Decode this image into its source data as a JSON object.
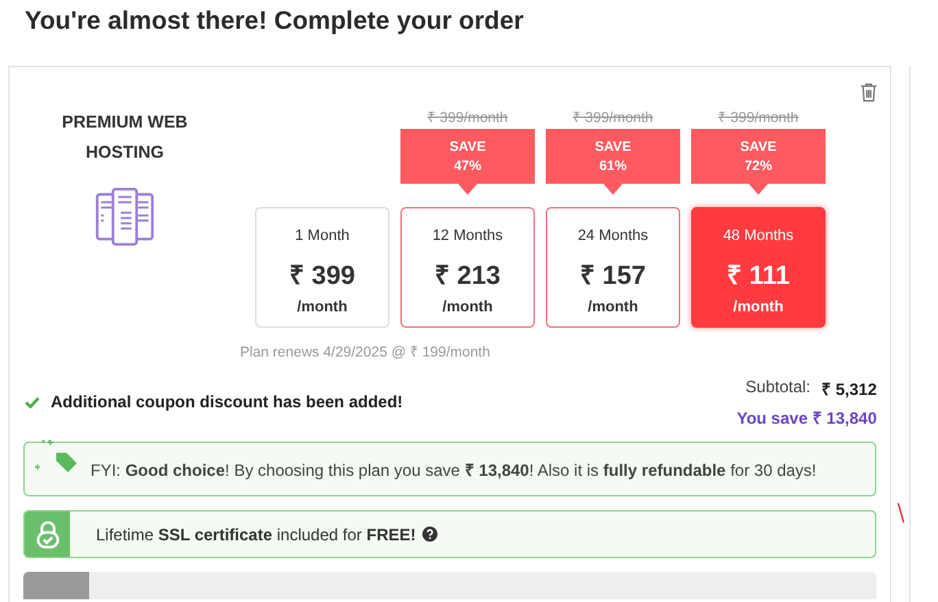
{
  "heading": "You're almost there! Complete your order",
  "product": {
    "name": "PREMIUM WEB HOSTING"
  },
  "plans": [
    {
      "term": "1 Month",
      "price": "₹ 399",
      "per": "/month",
      "selected": false
    },
    {
      "term": "12 Months",
      "price": "₹ 213",
      "per": "/month",
      "selected": false,
      "old_price": "₹ 399/month",
      "save_label": "SAVE",
      "save": "47%"
    },
    {
      "term": "24 Months",
      "price": "₹ 157",
      "per": "/month",
      "selected": false,
      "old_price": "₹ 399/month",
      "save_label": "SAVE",
      "save": "61%"
    },
    {
      "term": "48 Months",
      "price": "₹ 111",
      "per": "/month",
      "selected": true,
      "old_price": "₹ 399/month",
      "save_label": "SAVE",
      "save": "72%"
    }
  ],
  "renewal": "Plan renews 4/29/2025 @ ₹ 199/month",
  "coupon_message": "Additional coupon discount has been added!",
  "subtotal": {
    "label": "Subtotal:",
    "value": "₹ 5,312"
  },
  "savings": "You save ₹ 13,840",
  "fyi": "FYI: **Good choice**! By choosing this plan you save **₹ 13,840**! Also it is **fully refundable** for 30 days!",
  "ssl": "Lifetime **SSL certificate** included for **FREE!**"
}
